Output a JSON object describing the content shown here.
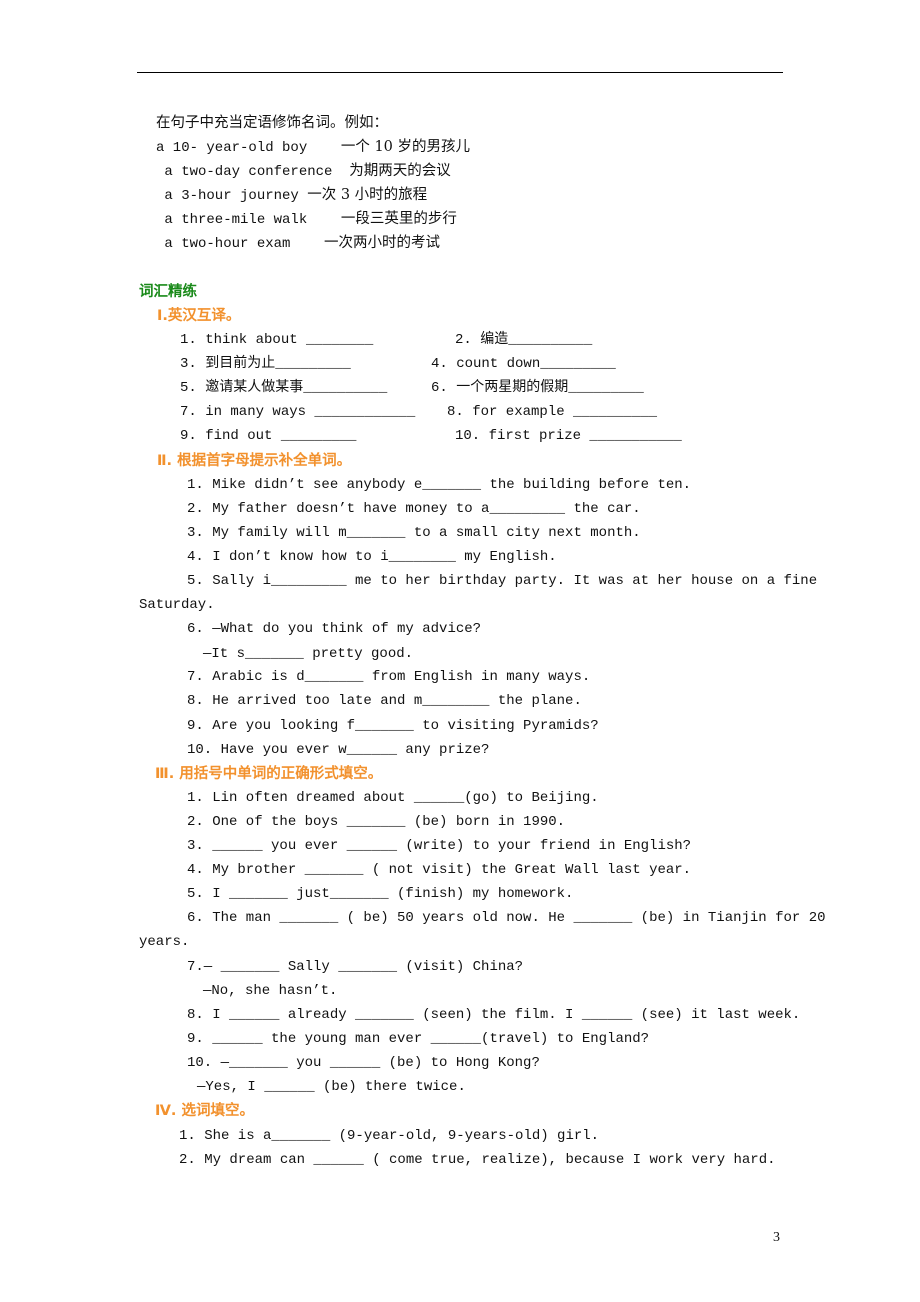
{
  "intro": {
    "heading": "在句子中充当定语修饰名词。例如：",
    "examples": [
      {
        "en": "a 10- year-old boy    ",
        "zh": "一个 10 岁的男孩儿"
      },
      {
        "en": " a two-day conference  ",
        "zh": "为期两天的会议"
      },
      {
        "en": " a 3-hour journey ",
        "zh": "一次 3 小时的旅程"
      },
      {
        "en": " a three-mile walk    ",
        "zh": "一段三英里的步行"
      },
      {
        "en": " a two-hour exam    ",
        "zh": "一次两小时的考试"
      }
    ]
  },
  "section_title": "词汇精练",
  "part1": {
    "title": "Ⅰ.英汉互译。",
    "items": [
      "1. think about ________",
      "2. 编造__________",
      "3. 到目前为止_________",
      "4. count down_________",
      "5. 邀请某人做某事__________",
      "6. 一个两星期的假期_________",
      "7. in many ways ____________",
      "8. for example __________",
      "9. find out _________",
      "10. first prize ___________"
    ]
  },
  "part2": {
    "title": "Ⅱ. 根据首字母提示补全单词。",
    "lines": [
      "1. Mike didn’t see anybody e_______ the building before ten.",
      "2. My father doesn’t have money to a_________ the car.",
      "3. My family will m_______ to a small city next month.",
      "4. I don’t know how to i________ my English.",
      "5. Sally i_________ me to her birthday party. It was at her house on a fine",
      "Saturday.",
      "6. —What do you think of my advice?",
      "—It s_______ pretty good.",
      "7. Arabic is d_______ from English in many ways.",
      "8. He arrived too late and m________ the plane.",
      "9. Are you looking f_______ to visiting Pyramids?",
      "10. Have you ever w______ any prize?"
    ]
  },
  "part3": {
    "title": "Ⅲ. 用括号中单词的正确形式填空。",
    "lines": [
      "1. Lin often dreamed about ______(go) to Beijing.",
      "2. One of the boys _______ (be) born in 1990.",
      "3. ______ you ever ______ (write) to your friend in English?",
      "4. My brother _______ ( not visit) the Great Wall last year.",
      "5. I _______ just_______ (finish) my homework.",
      "6. The man _______ ( be) 50 years old now. He _______ (be) in Tianjin for 20",
      "years.",
      "7.— _______ Sally _______ (visit) China?",
      "—No, she hasn’t.",
      "8. I ______ already _______ (seen) the film. I ______ (see) it last week.",
      "9. ______ the young man ever ______(travel) to England?",
      "10. —_______ you ______ (be) to Hong Kong?",
      "—Yes, I ______ (be) there twice."
    ]
  },
  "part4": {
    "title": "Ⅳ. 选词填空。",
    "lines": [
      "1. She is a_______ (9-year-old, 9-years-old) girl.",
      "2. My dream can ______ ( come true, realize), because I work very hard."
    ]
  },
  "page_number": "3"
}
